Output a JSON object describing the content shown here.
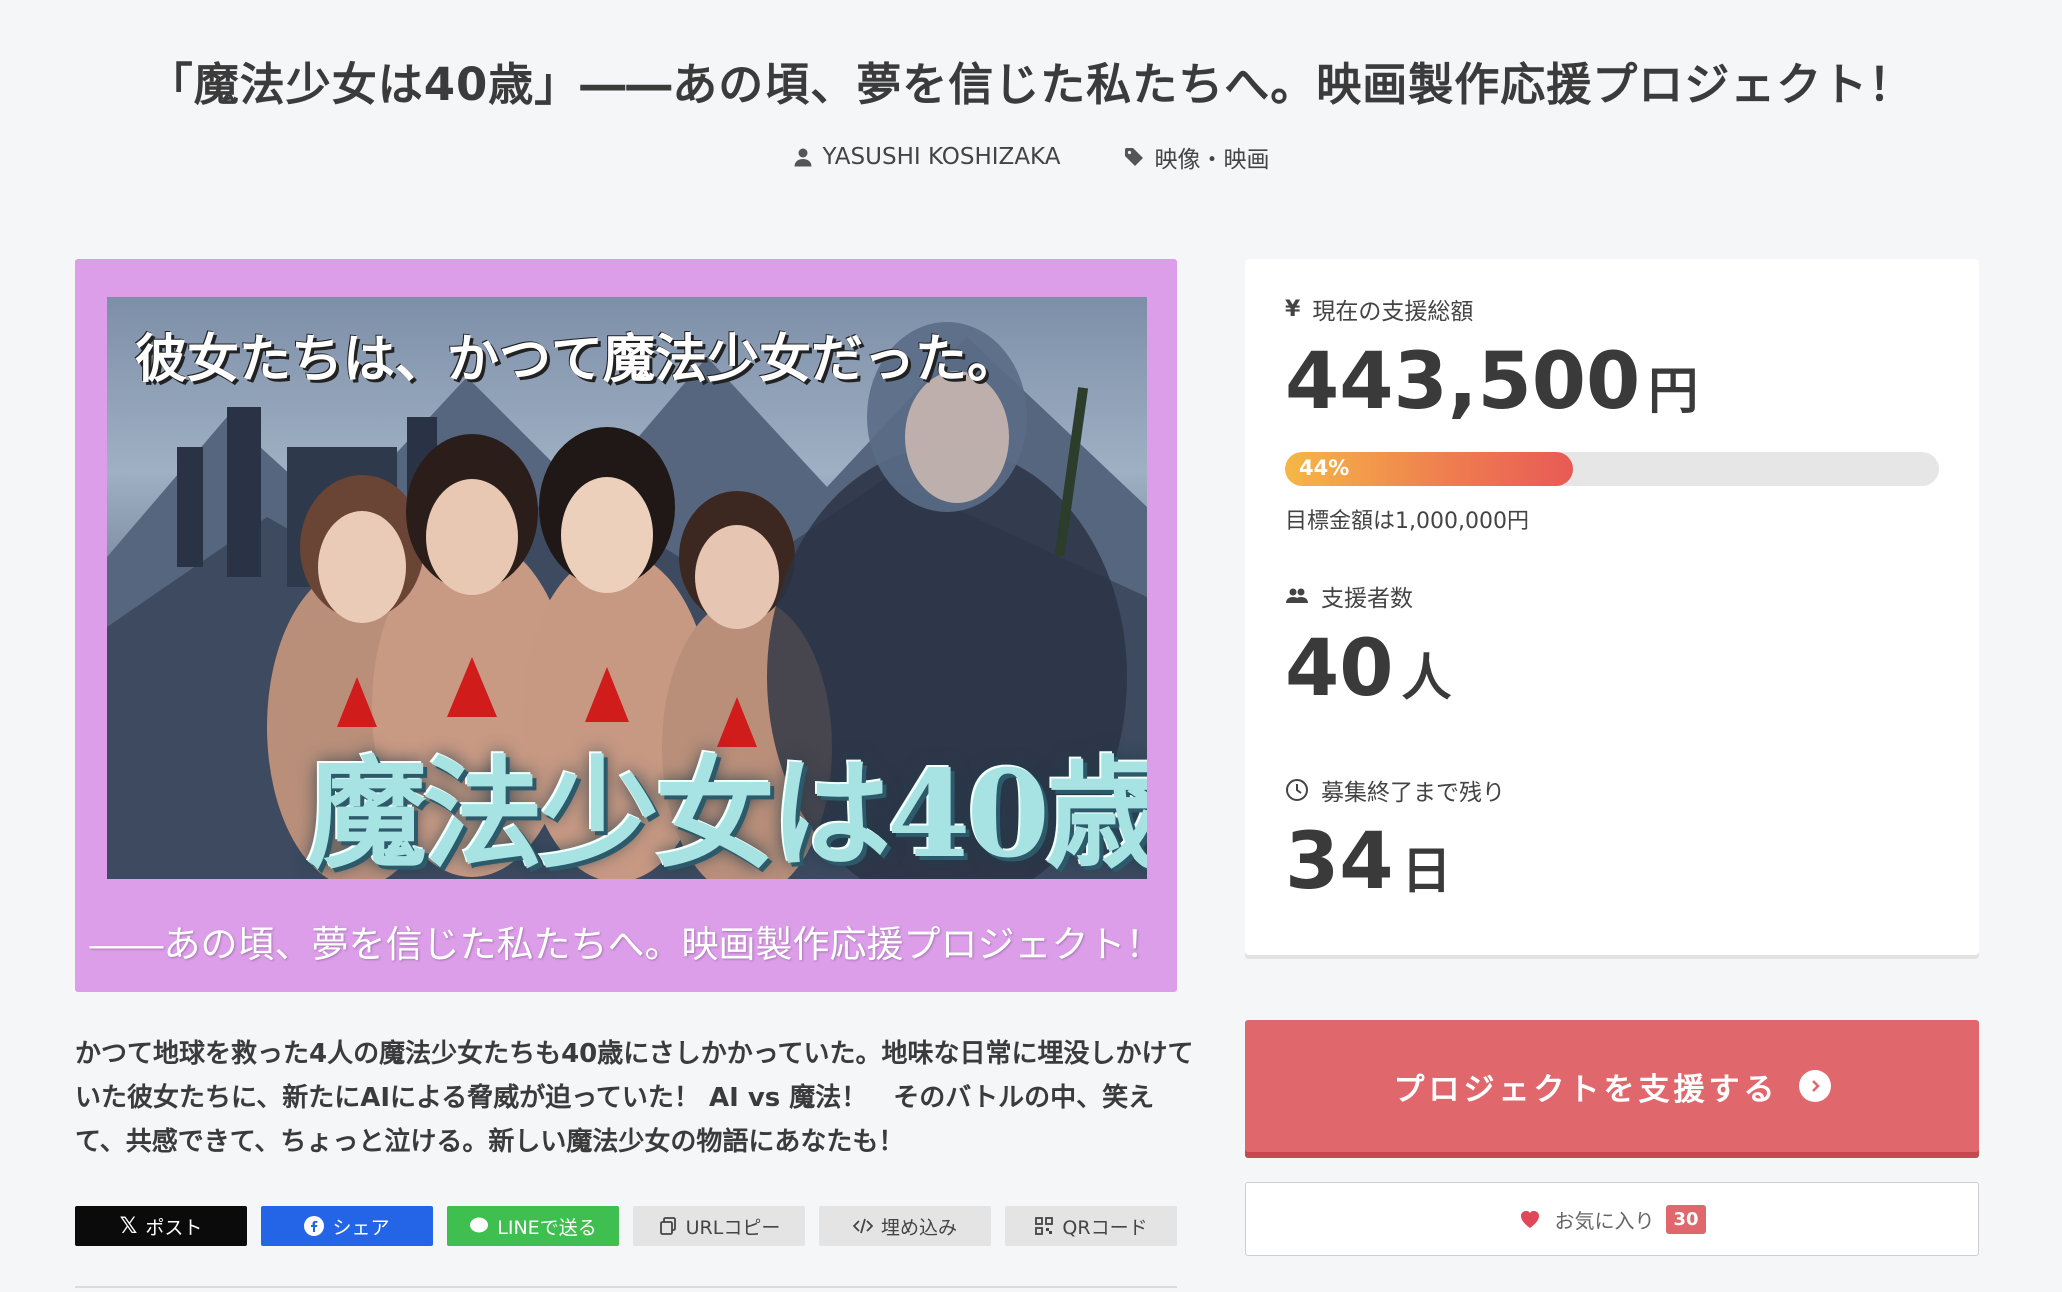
{
  "project": {
    "title": "「魔法少女は40歳」――あの頃、夢を信じた私たちへ。映画製作応援プロジェクト！",
    "author": "YASUSHI KOSHIZAKA",
    "category": "映像・映画"
  },
  "hero": {
    "headline": "彼女たちは、かつて魔法少女だった。",
    "logo_text": "魔法少女は40歳",
    "subtitle": "――あの頃、夢を信じた私たちへ。映画製作応援プロジェクト！"
  },
  "stats": {
    "total_label": "現在の支援総額",
    "total_amount": "443,500",
    "currency_unit": "円",
    "progress_percent": 44,
    "progress_label": "44%",
    "goal_text": "目標金額は1,000,000円",
    "backers_label": "支援者数",
    "backers_count": "40",
    "backers_unit": "人",
    "remaining_label": "募集終了まで残り",
    "remaining_days": "34",
    "remaining_unit": "日"
  },
  "actions": {
    "support_label": "プロジェクトを支援する",
    "favorite_label": "お気に入り",
    "favorite_count": "30"
  },
  "description": "かつて地球を救った4人の魔法少女たちも40歳にさしかかっていた。地味な日常に埋没しかけていた彼女たちに、新たにAIによる脅威が迫っていた！ AI vs 魔法！　そのバトルの中、笑えて、共感できて、ちょっと泣ける。新しい魔法少女の物語にあなたも！",
  "share": {
    "x_label": "ポスト",
    "facebook_label": "シェア",
    "line_label": "LINEで送る",
    "url_copy_label": "URLコピー",
    "embed_label": "埋め込み",
    "qr_label": "QRコード"
  },
  "colors": {
    "accent": "#e0686d",
    "hero_background": "#dc9ee9",
    "facebook": "#2465e8",
    "line": "#3fbf4f"
  }
}
